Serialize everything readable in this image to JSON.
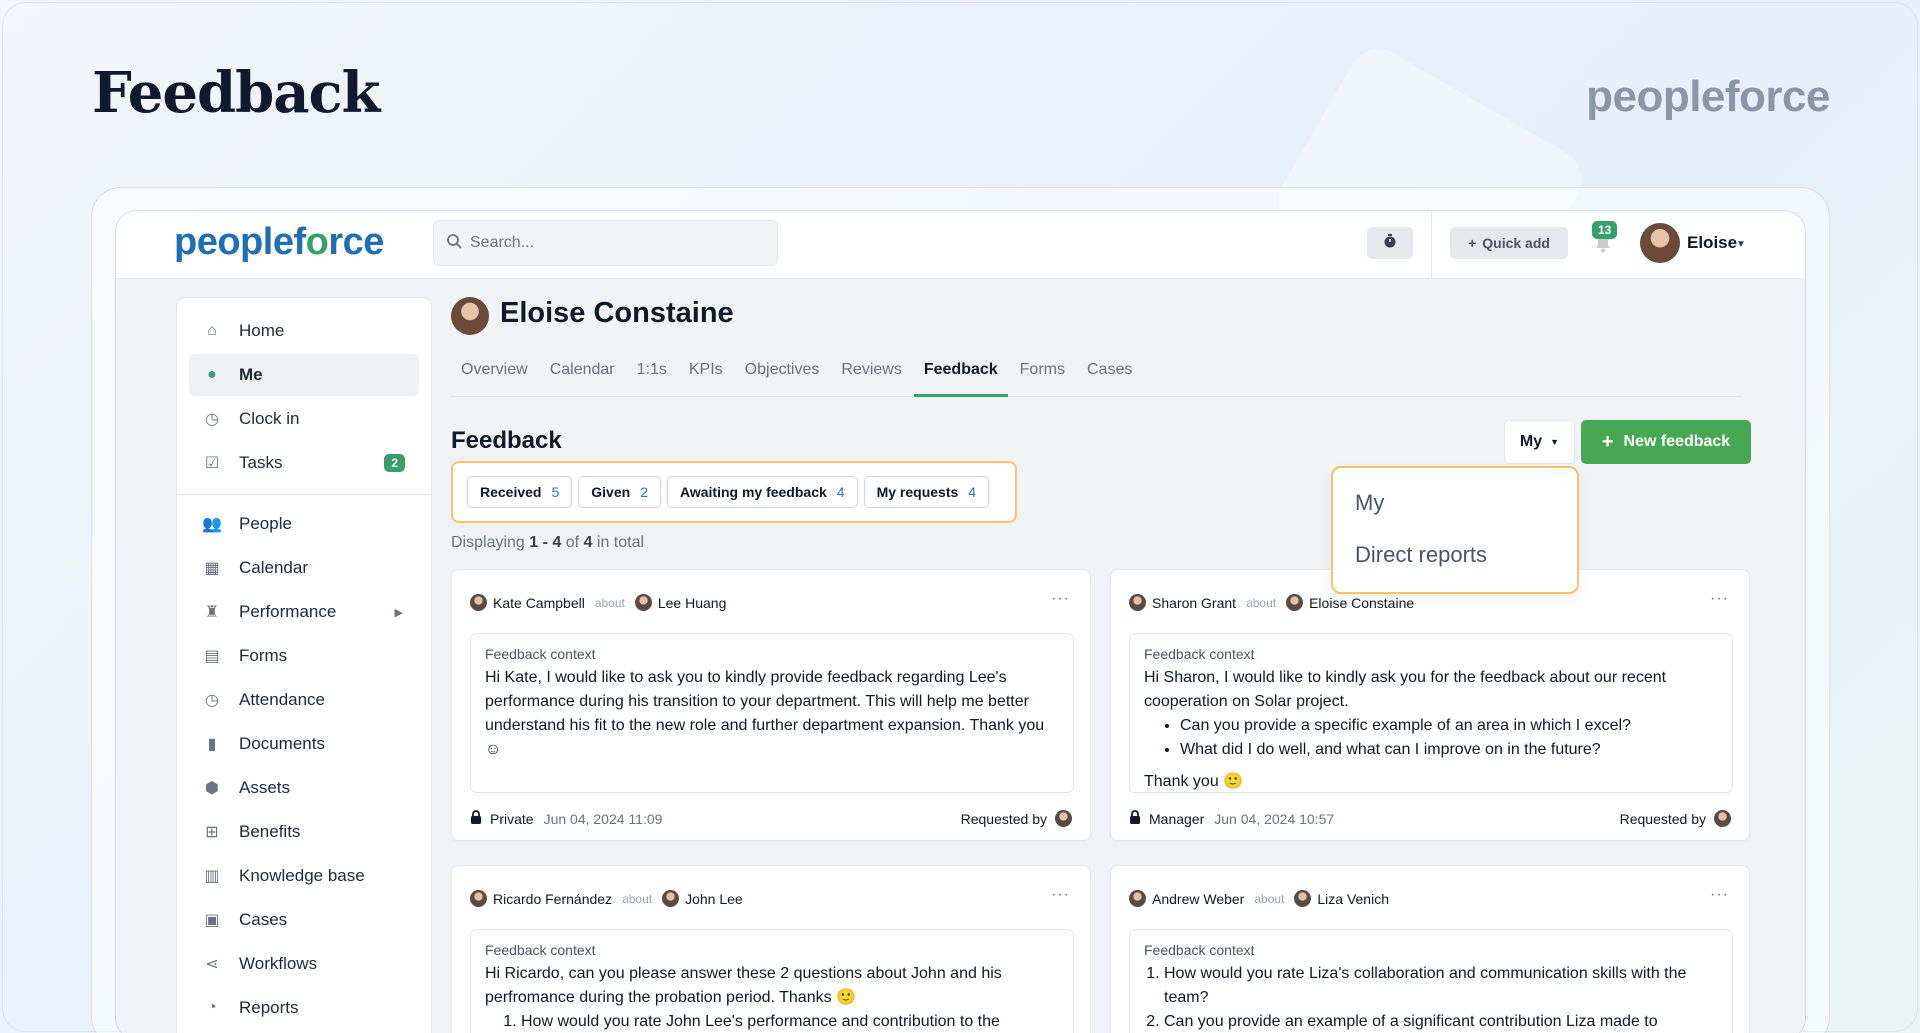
{
  "hero": {
    "title": "Feedback",
    "logo": "peopleforce"
  },
  "topbar": {
    "logo_left": "peopl",
    "logo_mid": "e",
    "logo_rest": "f",
    "logo_o": "o",
    "logo_end": "rce",
    "search_placeholder": "Search...",
    "quick_add": "Quick add",
    "notifications": "13",
    "user_name": "Eloise"
  },
  "sidebar": {
    "items": [
      {
        "label": "Home",
        "icon": "home-icon"
      },
      {
        "label": "Me",
        "icon": "person-icon",
        "active": true
      },
      {
        "label": "Clock in",
        "icon": "clock-icon"
      },
      {
        "label": "Tasks",
        "icon": "checkbox-icon",
        "badge": "2"
      },
      {
        "label": "People",
        "icon": "people-icon"
      },
      {
        "label": "Calendar",
        "icon": "calendar-icon"
      },
      {
        "label": "Performance",
        "icon": "trophy-icon"
      },
      {
        "label": "Forms",
        "icon": "clipboard-icon"
      },
      {
        "label": "Attendance",
        "icon": "clock-icon"
      },
      {
        "label": "Documents",
        "icon": "document-icon"
      },
      {
        "label": "Assets",
        "icon": "boxes-icon"
      },
      {
        "label": "Benefits",
        "icon": "gift-icon"
      },
      {
        "label": "Knowledge base",
        "icon": "books-icon"
      },
      {
        "label": "Cases",
        "icon": "chat-icon"
      },
      {
        "label": "Workflows",
        "icon": "workflow-icon"
      },
      {
        "label": "Reports",
        "icon": "pie-chart-icon"
      }
    ]
  },
  "profile": {
    "name": "Eloise Constaine"
  },
  "tabs": [
    "Overview",
    "Calendar",
    "1:1s",
    "KPIs",
    "Objectives",
    "Reviews",
    "Feedback",
    "Forms",
    "Cases"
  ],
  "feedback": {
    "title": "Feedback",
    "scope_select": "My",
    "new_button": "New feedback",
    "filters": [
      {
        "label": "Received",
        "count": "5"
      },
      {
        "label": "Given",
        "count": "2"
      },
      {
        "label": "Awaiting my feedback",
        "count": "4"
      },
      {
        "label": "My requests",
        "count": "4"
      }
    ],
    "displaying_prefix": "Displaying",
    "displaying_range": "1 - 4",
    "displaying_of": "of",
    "displaying_total": "4",
    "displaying_suffix": "in total",
    "dropdown": [
      "My",
      "Direct reports"
    ]
  },
  "cards": [
    {
      "from": "Kate Campbell",
      "about_word": "about",
      "to": "Lee Huang",
      "context_label": "Feedback context",
      "text": "Hi Kate, I would like to ask you to kindly provide feedback regarding Lee's performance during his transition to your department. This will help me better understand his fit to the new role and further department expansion. Thank you ☺",
      "visibility": "Private",
      "date": "Jun 04, 2024 11:09",
      "requested_by": "Requested by"
    },
    {
      "from": "Sharon Grant",
      "about_word": "about",
      "to": "Eloise Constaine",
      "context_label": "Feedback context",
      "text": "Hi Sharon, I would like to kindly ask you for the feedback about our recent cooperation on Solar project.",
      "bullets": [
        "Can you provide a specific example of an area in which I excel?",
        "What did I do well, and what can I improve on in the future?"
      ],
      "after": "Thank you 🙂",
      "visibility": "Manager",
      "date": "Jun 04, 2024 10:57",
      "requested_by": "Requested by"
    },
    {
      "from": "Ricardo Fernández",
      "about_word": "about",
      "to": "John Lee",
      "context_label": "Feedback context",
      "text": "Hi Ricardo, can you please answer these 2 questions about John and his perfromance during the probation period. Thanks 🙂",
      "numbered": [
        "How would you rate John Lee's performance and contribution to the"
      ]
    },
    {
      "from": "Andrew Weber",
      "about_word": "about",
      "to": "Liza Venich",
      "context_label": "Feedback context",
      "numbered": [
        "How would you rate Liza's collaboration and communication skills with the team?",
        "Can you provide an example of a significant contribution Liza made to"
      ]
    }
  ]
}
